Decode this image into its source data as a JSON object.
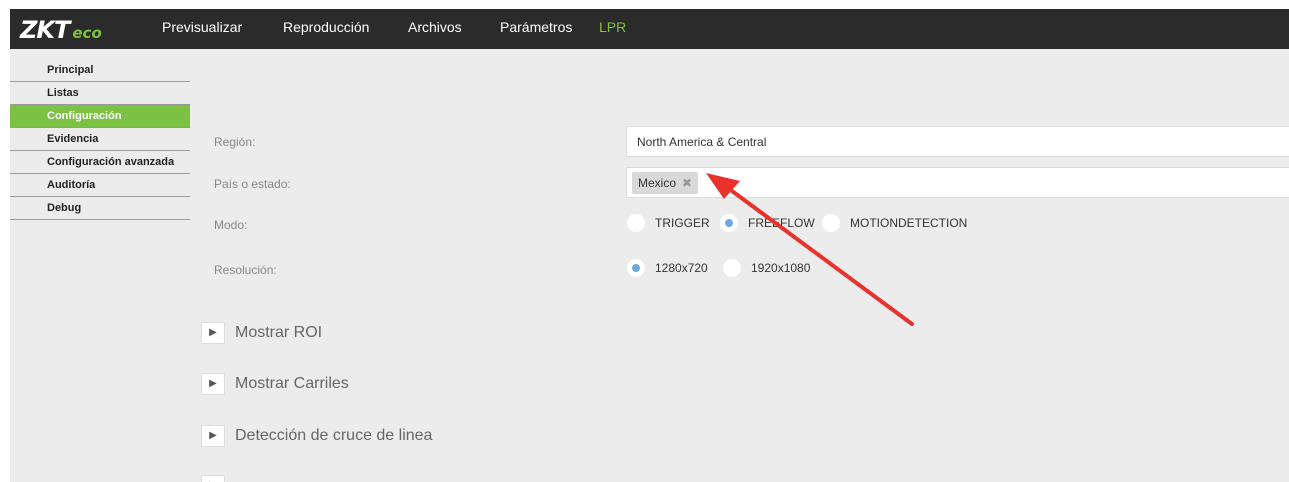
{
  "app": {
    "logo": {
      "main": "ZKT",
      "accent": "eco"
    },
    "colors": {
      "topbar": "#2b2b2b",
      "accent": "#7bc144",
      "background": "#ececec",
      "radio_selected": "#6fa8dc",
      "annotation_arrow": "#e8322b"
    }
  },
  "nav": {
    "items": [
      "Previsualizar",
      "Reproducción",
      "Archivos",
      "Parámetros",
      "LPR"
    ],
    "active": "LPR"
  },
  "sidebar": {
    "items": [
      "Principal",
      "Listas",
      "Configuración",
      "Evidencia",
      "Configuración avanzada",
      "Auditoría",
      "Debug"
    ],
    "active": "Configuración"
  },
  "form": {
    "region": {
      "label": "Región:",
      "value": "North America & Central"
    },
    "country": {
      "label": "País o estado:",
      "tag": "Mexico",
      "remove_icon": "✖"
    },
    "mode": {
      "label": "Modo:",
      "options": [
        "TRIGGER",
        "FREEFLOW",
        "MOTIONDETECTION"
      ],
      "selected": "FREEFLOW"
    },
    "resolution": {
      "label": "Resolución:",
      "options": [
        "1280x720",
        "1920x1080"
      ],
      "selected": "1280x720"
    }
  },
  "sections": [
    {
      "label": "Mostrar ROI",
      "icon": "expand-arrow-icon"
    },
    {
      "label": "Mostrar Carriles",
      "icon": "expand-arrow-icon"
    },
    {
      "label": "Detección de cruce de linea",
      "icon": "expand-arrow-icon"
    }
  ],
  "annotation": {
    "icon": "red-arrow-icon"
  }
}
